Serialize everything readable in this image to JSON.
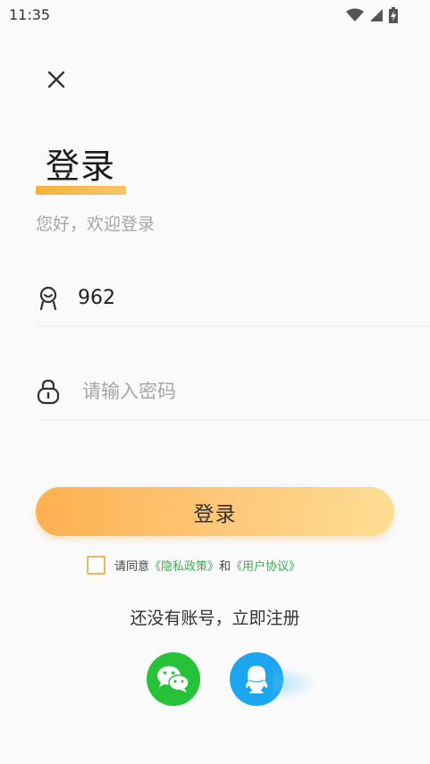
{
  "status_bar": {
    "time": "11:35"
  },
  "header": {
    "title": "登录",
    "subtitle": "您好，欢迎登录"
  },
  "form": {
    "username": {
      "value": "962",
      "icon": "user-icon"
    },
    "password": {
      "placeholder": "请输入密码",
      "icon": "lock-icon"
    },
    "submit_label": "登录"
  },
  "agreement": {
    "prefix": "请同意",
    "privacy_link": "《隐私政策》",
    "conjunction": "和",
    "terms_link": "《用户协议》",
    "checked": false
  },
  "register": {
    "label": "还没有账号，立即注册"
  },
  "social": {
    "wechat_icon": "wechat-icon",
    "qq_icon": "qq-icon"
  },
  "colors": {
    "accent": "#fdb04f",
    "link_green": "#3fad52",
    "wechat_green": "#26c33a",
    "qq_blue": "#1da6f0"
  }
}
